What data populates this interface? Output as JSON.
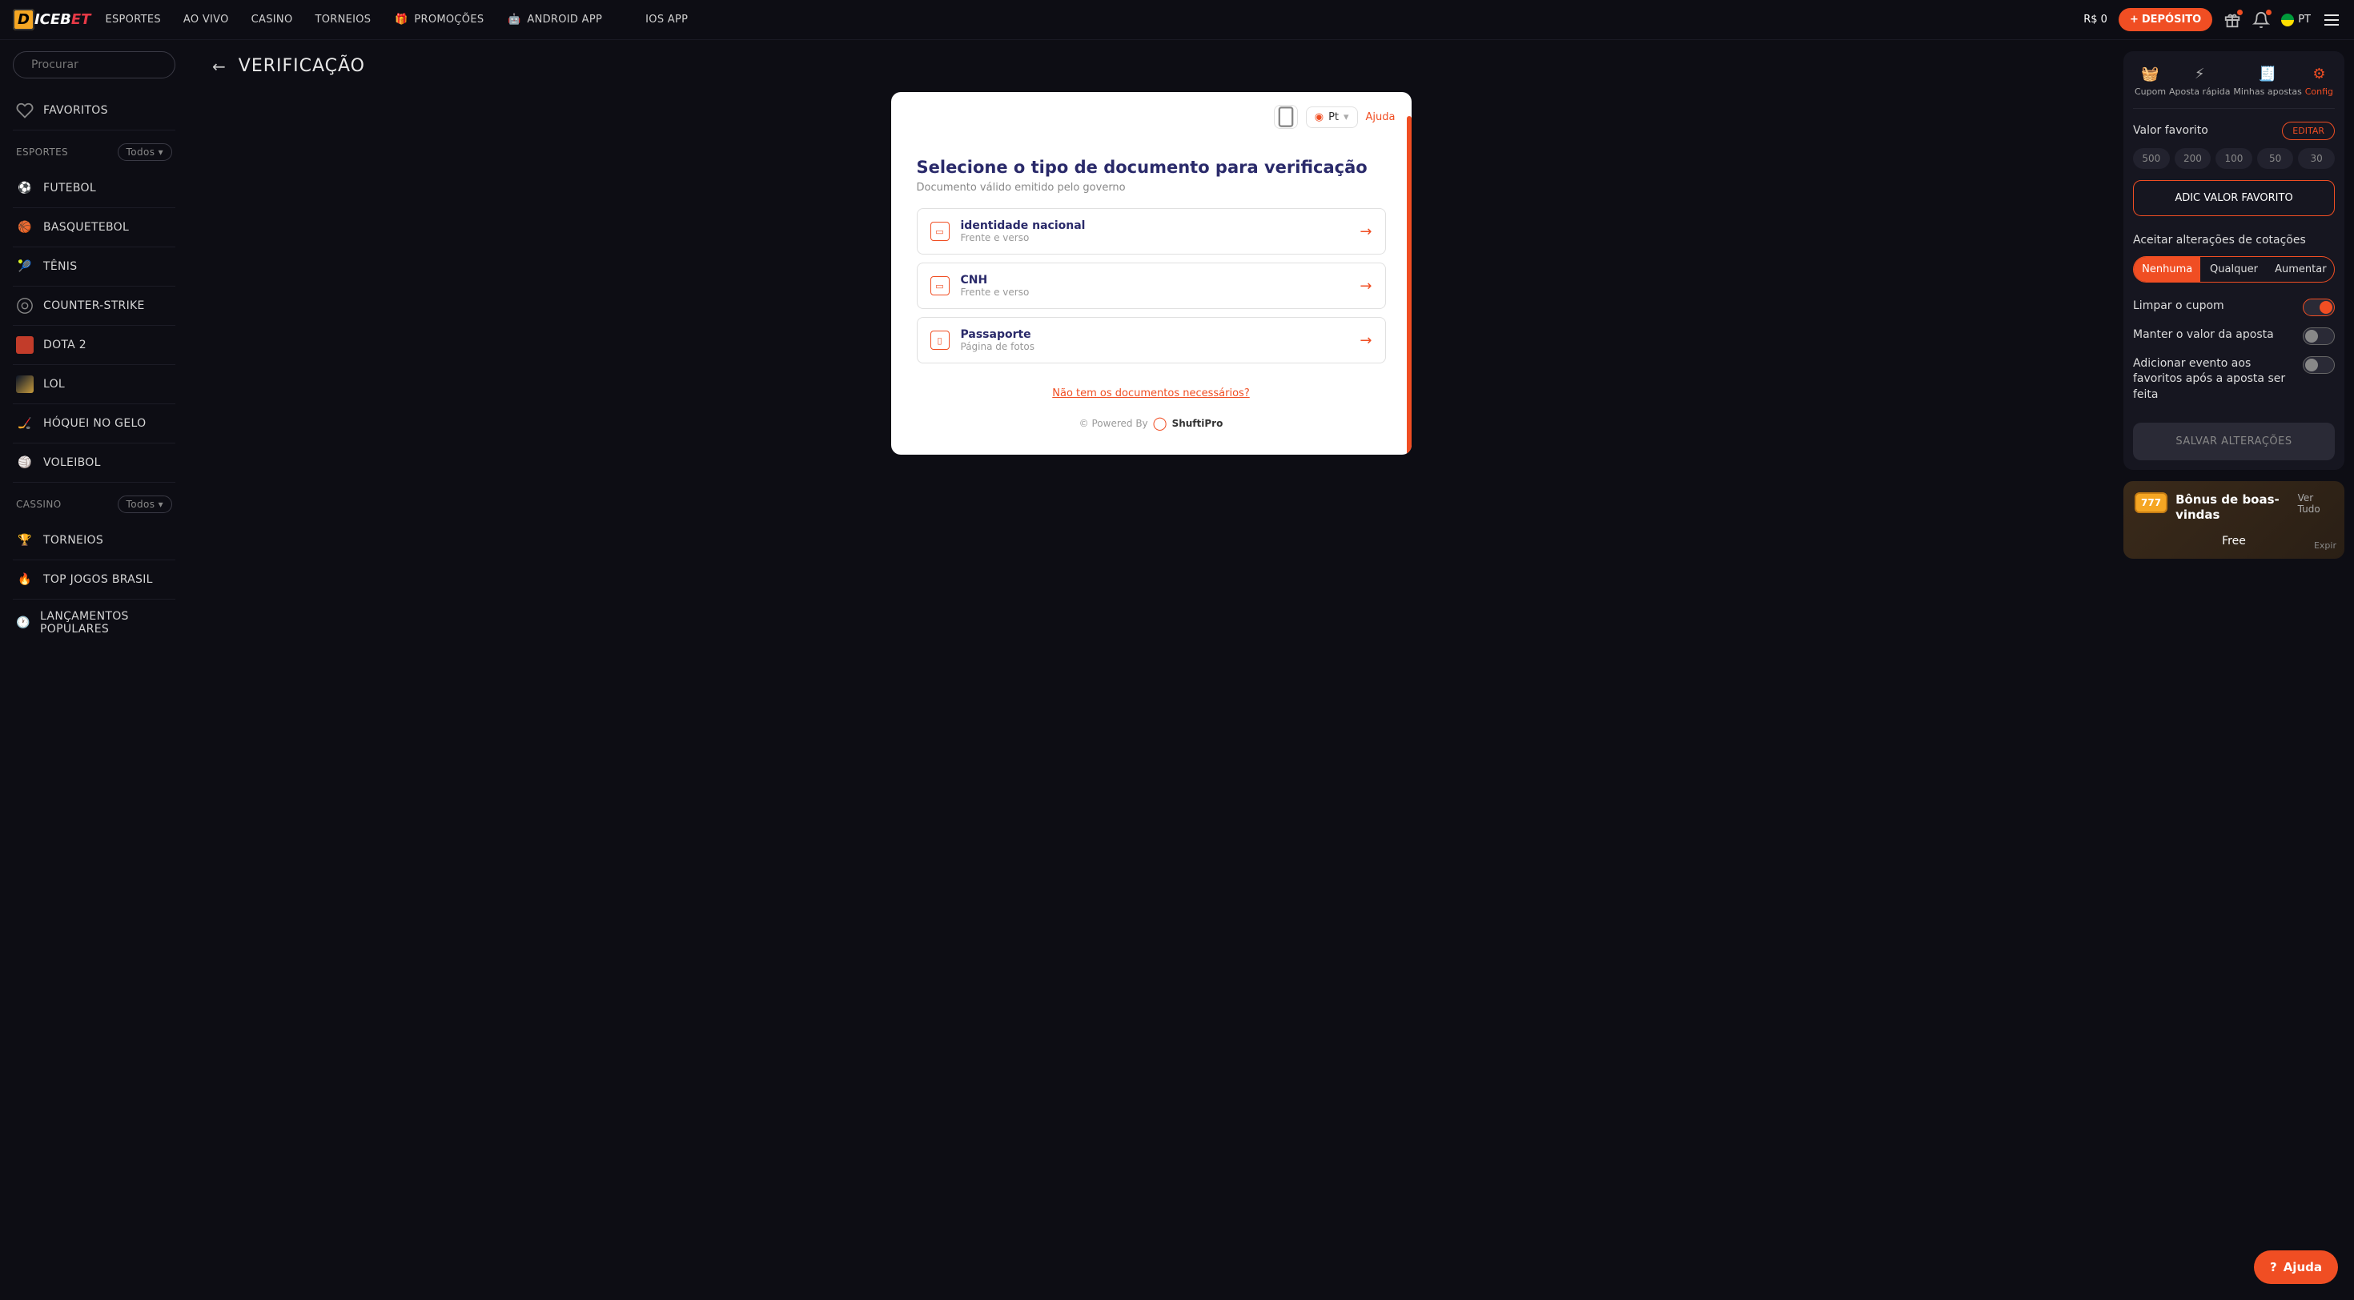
{
  "topnav": {
    "logo_part1": "D",
    "logo_part2": "ICEB",
    "logo_part3": "ET",
    "links": [
      "ESPORTES",
      "AO VIVO",
      "CASINO",
      "TORNEIOS",
      "PROMOÇÕES",
      "ANDROID APP",
      "IOS APP"
    ],
    "balance": "R$ 0",
    "deposit": "DEPÓSITO",
    "lang": "PT"
  },
  "sidebar": {
    "search_placeholder": "Procurar",
    "favorites": "FAVORITOS",
    "section_sports": "ESPORTES",
    "section_casino": "CASSINO",
    "chip_all": "Todos ▾",
    "sports": [
      "FUTEBOL",
      "BASQUETEBOL",
      "TÊNIS",
      "COUNTER-STRIKE",
      "DOTA 2",
      "LOL",
      "HÓQUEI NO GELO",
      "VOLEIBOL"
    ],
    "casino": [
      "TORNEIOS",
      "TOP JOGOS BRASIL",
      "LANÇAMENTOS POPULARES"
    ]
  },
  "page": {
    "title": "VERIFICAÇÃO"
  },
  "verify": {
    "lang": "Pt",
    "help": "Ajuda",
    "title": "Selecione o tipo de documento para verificação",
    "sub": "Documento válido emitido pelo governo",
    "docs": [
      {
        "name": "identidade nacional",
        "hint": "Frente e verso"
      },
      {
        "name": "CNH",
        "hint": "Frente e verso"
      },
      {
        "name": "Passaporte",
        "hint": "Página de fotos"
      }
    ],
    "no_docs": "Não tem os documentos necessários?",
    "powered": "© Powered By",
    "shufti": "ShuftiPro"
  },
  "rpanel": {
    "tabs": [
      "Cupom",
      "Aposta rápida",
      "Minhas apostas",
      "Config"
    ],
    "fav_label": "Valor favorito",
    "edit": "EDITAR",
    "amounts": [
      "500",
      "200",
      "100",
      "50",
      "30"
    ],
    "add_fav": "ADIC VALOR FAVORITO",
    "accept": "Aceitar alterações de cotações",
    "seg": [
      "Nenhuma",
      "Qualquer",
      "Aumentar"
    ],
    "toggles": [
      "Limpar o cupom",
      "Manter o valor da aposta",
      "Adicionar evento aos favoritos após a aposta ser feita"
    ],
    "save": "SALVAR ALTERAÇÕES"
  },
  "bonus": {
    "slot": "777",
    "title": "Bônus de boas-vindas",
    "all": "Ver Tudo",
    "free": "Free",
    "expir": "Expir"
  },
  "help_fab": "Ajuda"
}
